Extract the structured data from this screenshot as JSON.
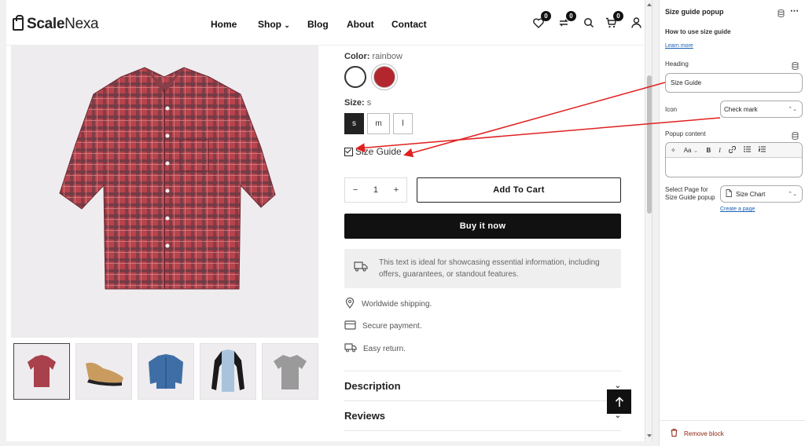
{
  "store": {
    "logo": {
      "part1": "Scale",
      "part2": "Nexa"
    },
    "nav": [
      "Home",
      "Shop",
      "Blog",
      "About",
      "Contact"
    ],
    "badges": {
      "wishlist": "0",
      "compare": "0",
      "cart": "0"
    }
  },
  "product": {
    "color_label": "Color:",
    "color_value": "rainbow",
    "size_label": "Size:",
    "size_value": "s",
    "sizes": [
      "s",
      "m",
      "l"
    ],
    "size_guide": "Size Guide",
    "quantity": "1",
    "qty_minus": "−",
    "qty_plus": "+",
    "add_to_cart": "Add To Cart",
    "buy_now": "Buy it now",
    "info_text": "This text is ideal for showcasing essential information, including offers, guarantees, or standout features.",
    "features": [
      "Worldwide shipping.",
      "Secure payment.",
      "Easy return."
    ],
    "accordions": [
      "Description",
      "Reviews"
    ]
  },
  "panel": {
    "title": "Size guide popup",
    "howto": "How to use size guide",
    "learn_more": "Learn more",
    "heading_label": "Heading",
    "heading_value": "Size Guide",
    "icon_label": "Icon",
    "icon_value": "Check mark",
    "popup_label": "Popup content",
    "rte": {
      "ai": "✧",
      "aa": "Aa",
      "bold": "B",
      "italic": "I"
    },
    "select_label": "Select Page for Size Guide popup",
    "page_value": "Size Chart",
    "create_page": "Create a page",
    "remove": "Remove block"
  },
  "colors": {
    "accent_arrow": "#e02020",
    "remove_red": "#8e1f0b",
    "swatch_red": "#b3262d"
  }
}
